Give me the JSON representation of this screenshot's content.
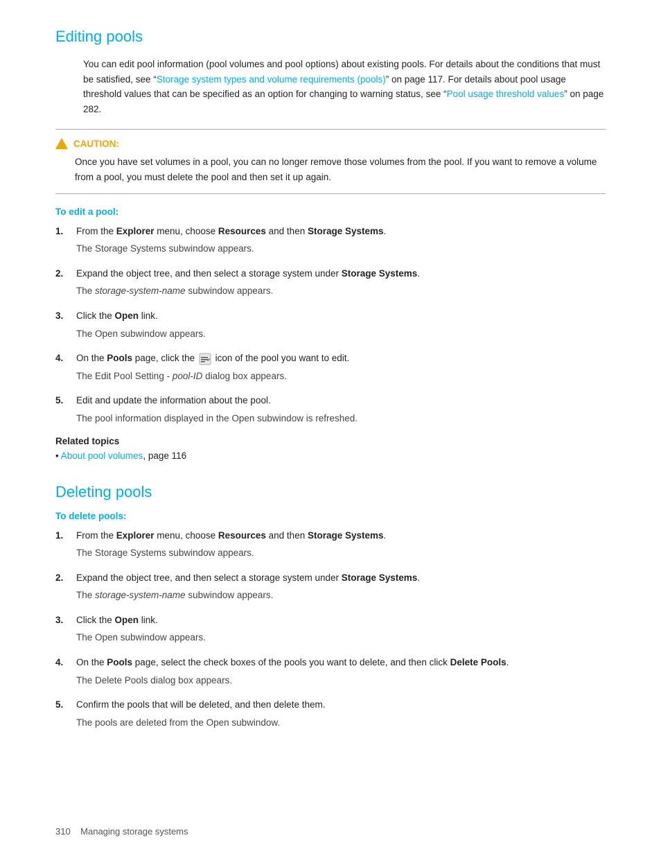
{
  "editing_pools": {
    "title": "Editing pools",
    "intro": {
      "text_before_link1": "You can edit pool information (pool volumes and pool options) about existing pools. For details about the conditions that must be satisfied, see “",
      "link1_text": "Storage system types and volume requirements (pools)",
      "link1_page": "117",
      "text_between": "” on page 117. For details about pool usage threshold values that can be specified as an option for changing to warning status, see “",
      "link2_text": "Pool usage threshold values",
      "link2_page": "282",
      "text_after": "” on page 282."
    },
    "caution": {
      "label": "CAUTION:",
      "text": "Once you have set volumes in a pool, you can no longer remove those volumes from the pool. If you want to remove a volume from a pool, you must delete the pool and then set it up again."
    },
    "to_edit_heading": "To edit a pool:",
    "steps": [
      {
        "num": "1.",
        "text_parts": [
          {
            "text": "From the ",
            "bold": false
          },
          {
            "text": "Explorer",
            "bold": true
          },
          {
            "text": " menu, choose ",
            "bold": false
          },
          {
            "text": "Resources",
            "bold": true
          },
          {
            "text": " and then ",
            "bold": false
          },
          {
            "text": "Storage Systems",
            "bold": true
          },
          {
            "text": ".",
            "bold": false
          }
        ],
        "sub": "The Storage Systems subwindow appears.",
        "sub_italic": false
      },
      {
        "num": "2.",
        "text_parts": [
          {
            "text": "Expand the object tree, and then select a storage system under ",
            "bold": false
          },
          {
            "text": "Storage Systems",
            "bold": true
          },
          {
            "text": ".",
            "bold": false
          }
        ],
        "sub": "The storage-system-name subwindow appears.",
        "sub_italic": true
      },
      {
        "num": "3.",
        "text_parts": [
          {
            "text": "Click the ",
            "bold": false
          },
          {
            "text": "Open",
            "bold": true
          },
          {
            "text": " link.",
            "bold": false
          }
        ],
        "sub": "The Open subwindow appears.",
        "sub_italic": false
      },
      {
        "num": "4.",
        "text_parts": [
          {
            "text": "On the ",
            "bold": false
          },
          {
            "text": "Pools",
            "bold": true
          },
          {
            "text": " page, click the ",
            "bold": false
          },
          {
            "text": "[edit-icon]",
            "bold": false,
            "is_icon": true
          },
          {
            "text": " icon of the pool you want to edit.",
            "bold": false
          }
        ],
        "sub": "The Edit Pool Setting - pool-ID dialog box appears.",
        "sub_italic": true,
        "sub_italic_part": "pool-ID"
      },
      {
        "num": "5.",
        "text_parts": [
          {
            "text": "Edit and update the information about the pool.",
            "bold": false
          }
        ],
        "sub": "The pool information displayed in the Open subwindow is refreshed.",
        "sub_italic": false
      }
    ],
    "related_topics": {
      "heading": "Related topics",
      "items": [
        {
          "link_text": "About pool volumes",
          "after_text": ", page 116"
        }
      ]
    }
  },
  "deleting_pools": {
    "title": "Deleting pools",
    "to_delete_heading": "To delete pools:",
    "steps": [
      {
        "num": "1.",
        "text_parts": [
          {
            "text": "From the ",
            "bold": false
          },
          {
            "text": "Explorer",
            "bold": true
          },
          {
            "text": " menu, choose ",
            "bold": false
          },
          {
            "text": "Resources",
            "bold": true
          },
          {
            "text": " and then ",
            "bold": false
          },
          {
            "text": "Storage Systems",
            "bold": true
          },
          {
            "text": ".",
            "bold": false
          }
        ],
        "sub": "The Storage Systems subwindow appears.",
        "sub_italic": false
      },
      {
        "num": "2.",
        "text_parts": [
          {
            "text": "Expand the object tree, and then select a storage system under ",
            "bold": false
          },
          {
            "text": "Storage Systems",
            "bold": true
          },
          {
            "text": ".",
            "bold": false
          }
        ],
        "sub": "The storage-system-name subwindow appears.",
        "sub_italic": true
      },
      {
        "num": "3.",
        "text_parts": [
          {
            "text": "Click the ",
            "bold": false
          },
          {
            "text": "Open",
            "bold": true
          },
          {
            "text": " link.",
            "bold": false
          }
        ],
        "sub": "The Open subwindow appears.",
        "sub_italic": false
      },
      {
        "num": "4.",
        "text_parts": [
          {
            "text": "On the ",
            "bold": false
          },
          {
            "text": "Pools",
            "bold": true
          },
          {
            "text": " page, select the check boxes of the pools you want to delete, and then click ",
            "bold": false
          },
          {
            "text": "Delete Pools",
            "bold": true
          },
          {
            "text": ".",
            "bold": false
          }
        ],
        "sub": "The Delete Pools dialog box appears.",
        "sub_italic": false
      },
      {
        "num": "5.",
        "text_parts": [
          {
            "text": "Confirm the pools that will be deleted, and then delete them.",
            "bold": false
          }
        ],
        "sub": "The pools are deleted from the Open subwindow.",
        "sub_italic": false
      }
    ]
  },
  "footer": {
    "page_number": "310",
    "text": "Managing storage systems"
  }
}
